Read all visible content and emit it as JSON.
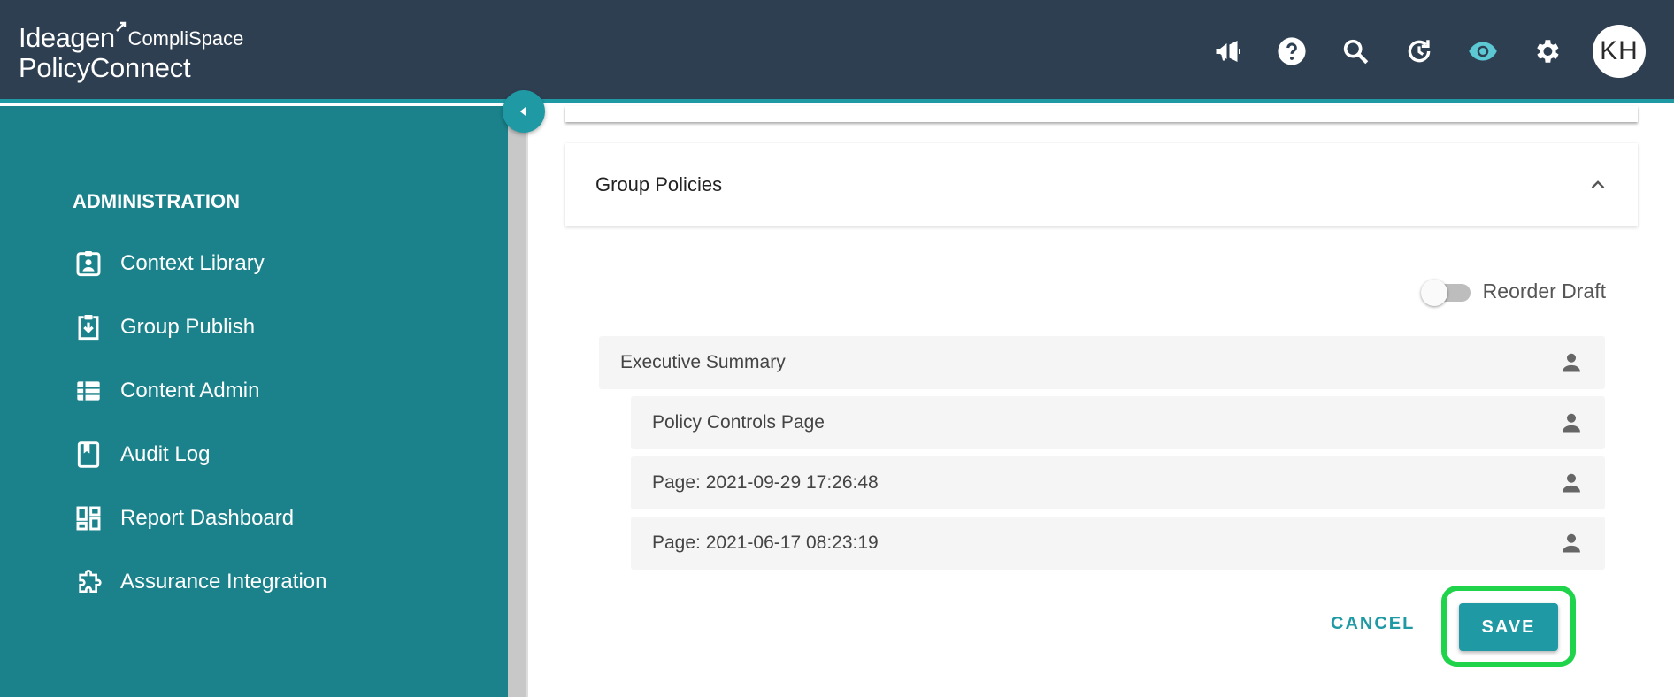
{
  "header": {
    "brand": "Ideagen",
    "sub_brand": "CompliSpace",
    "product": "PolicyConnect",
    "avatar_initials": "KH",
    "icons": [
      "megaphone-icon",
      "help-icon",
      "search-icon",
      "history-icon",
      "eye-icon",
      "gear-icon"
    ]
  },
  "sidebar": {
    "section_title": "ADMINISTRATION",
    "items": [
      {
        "label": "Context Library",
        "icon": "contact-badge-icon"
      },
      {
        "label": "Group Publish",
        "icon": "download-box-icon"
      },
      {
        "label": "Content Admin",
        "icon": "list-icon"
      },
      {
        "label": "Audit Log",
        "icon": "bookmark-book-icon"
      },
      {
        "label": "Report Dashboard",
        "icon": "dashboard-icon"
      },
      {
        "label": "Assurance Integration",
        "icon": "puzzle-icon"
      }
    ]
  },
  "main": {
    "panel_title": "Group Policies",
    "reorder_label": "Reorder Draft",
    "reorder_enabled": false,
    "rows": [
      {
        "label": "Executive Summary",
        "indent": 0
      },
      {
        "label": "Policy Controls Page",
        "indent": 1
      },
      {
        "label": "Page: 2021-09-29 17:26:48",
        "indent": 1
      },
      {
        "label": "Page: 2021-06-17 08:23:19",
        "indent": 1
      }
    ],
    "cancel_label": "CANCEL",
    "save_label": "SAVE"
  },
  "colors": {
    "header_bg": "#2f3f52",
    "sidebar_bg": "#1b828b",
    "accent": "#1f9aa4",
    "highlight": "#1fd34a"
  }
}
